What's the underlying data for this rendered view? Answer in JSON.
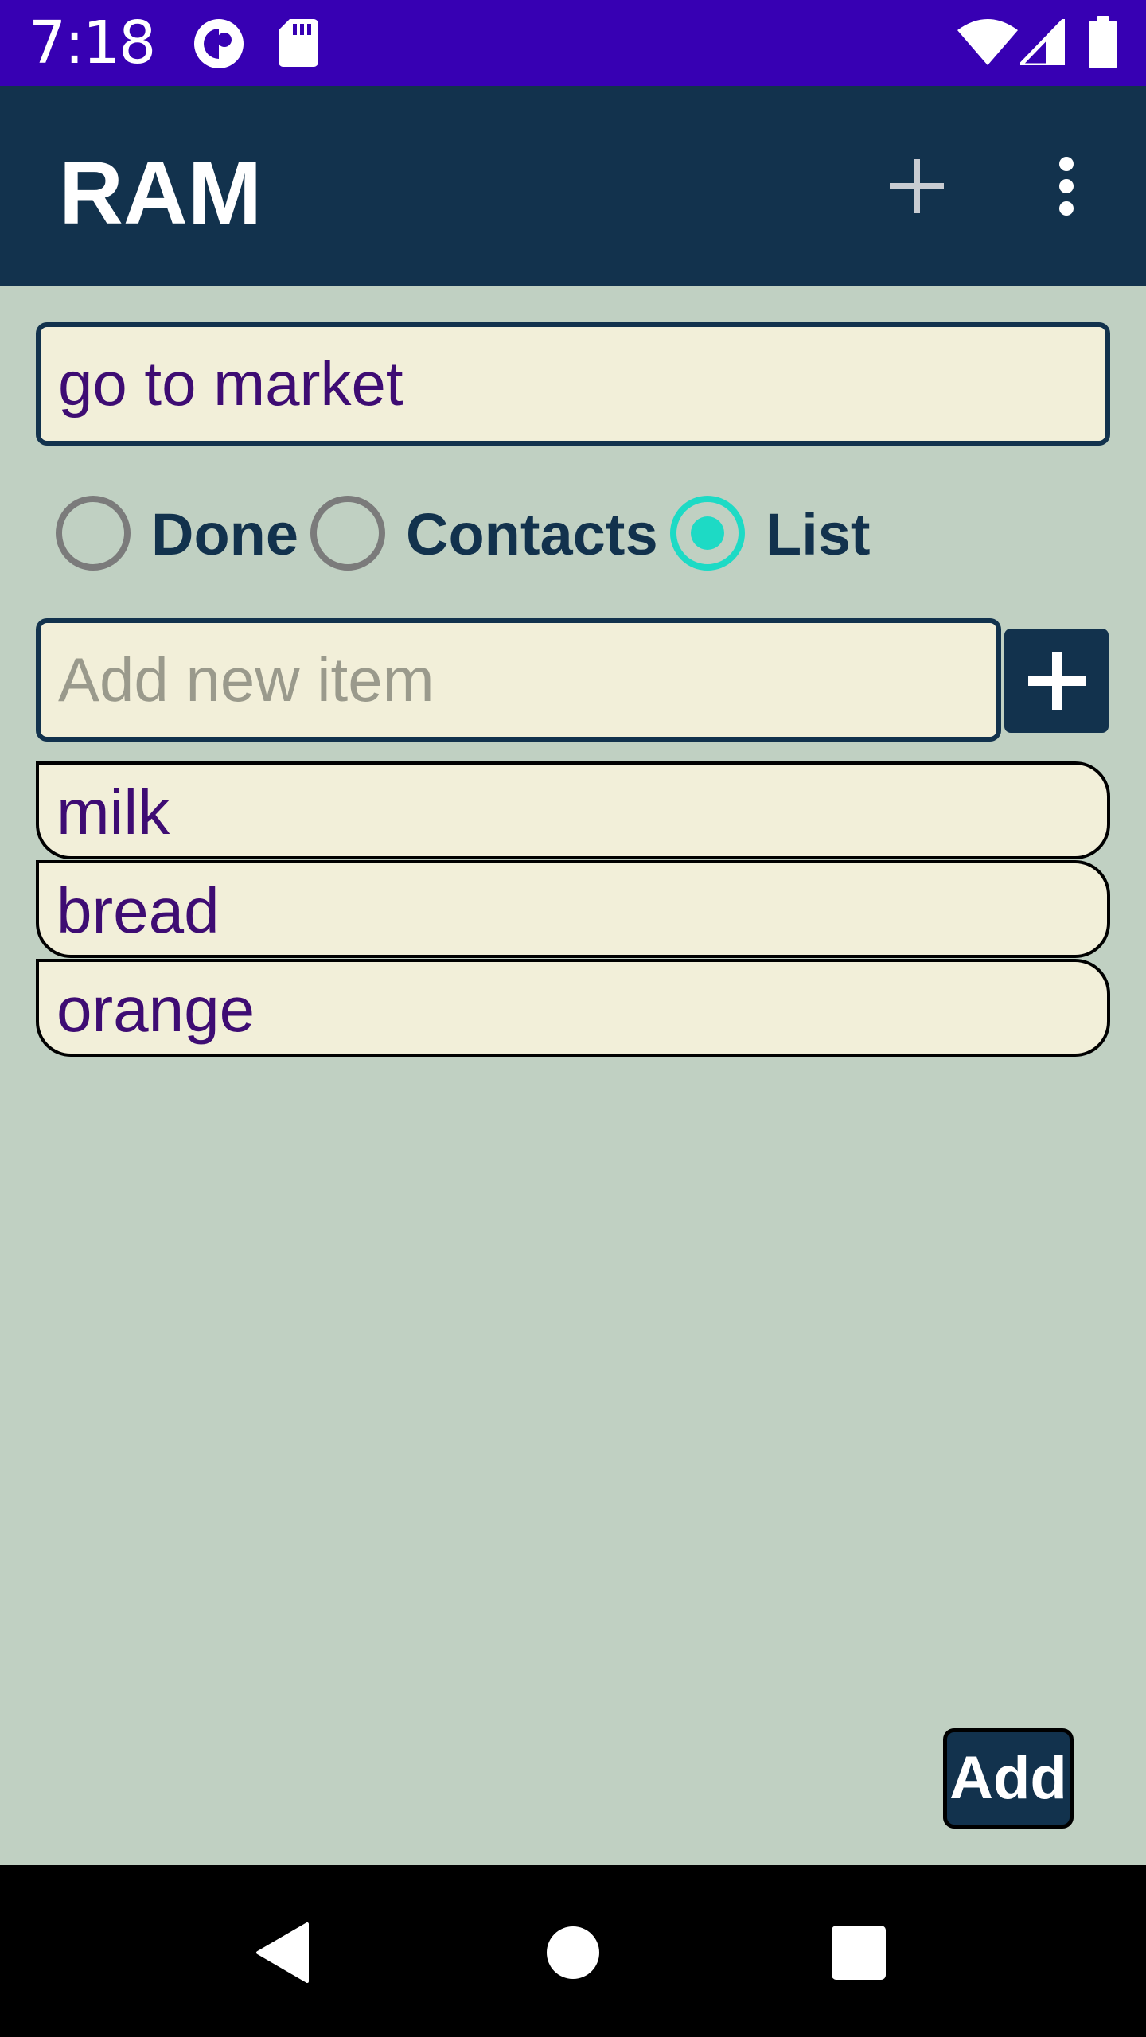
{
  "status_bar": {
    "time": "7:18",
    "icons": [
      "pocket-casts-icon",
      "sd-card-icon",
      "wifi-icon",
      "signal-icon",
      "battery-icon"
    ]
  },
  "app_bar": {
    "title": "RAM",
    "actions": [
      "add-icon",
      "more-vert-icon"
    ]
  },
  "title_field": {
    "value": "go to market"
  },
  "radio_group": {
    "options": [
      {
        "label": "Done",
        "checked": false
      },
      {
        "label": "Contacts",
        "checked": false
      },
      {
        "label": "List",
        "checked": true
      }
    ]
  },
  "new_item": {
    "placeholder": "Add new item",
    "value": ""
  },
  "list": {
    "items": [
      {
        "text": "milk"
      },
      {
        "text": "bread"
      },
      {
        "text": "orange"
      }
    ]
  },
  "add_button": {
    "label": "Add"
  },
  "nav_bar": {
    "buttons": [
      "back-icon",
      "home-icon",
      "recents-icon"
    ]
  },
  "colors": {
    "status_bar": "#3700b3",
    "app_bar": "#12324d",
    "background": "#c0d0c2",
    "field_background": "#f2efd9",
    "text_purple": "#3e0c73",
    "accent": "#1ddac5"
  }
}
